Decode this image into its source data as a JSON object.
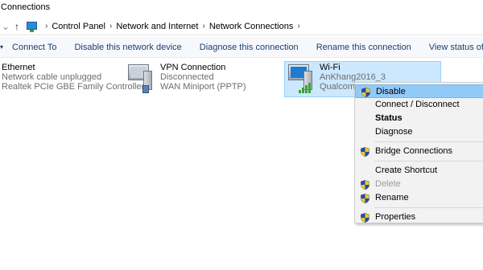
{
  "window": {
    "title": "Connections"
  },
  "address": {
    "back_icon": "chevron-down-icon",
    "up_icon": "up-arrow-icon",
    "breadcrumbs": [
      "Control Panel",
      "Network and Internet",
      "Network Connections"
    ]
  },
  "toolbar": {
    "buttons": [
      "Connect To",
      "Disable this network device",
      "Diagnose this connection",
      "Rename this connection",
      "View status of this connection"
    ]
  },
  "connections": {
    "ethernet": {
      "name": "Ethernet",
      "status": "Network cable unplugged",
      "device": "Realtek PCIe GBE Family Controller"
    },
    "vpn": {
      "name": "VPN Connection",
      "status": "Disconnected",
      "device": "WAN Miniport (PPTP)"
    },
    "wifi": {
      "name": "Wi-Fi",
      "status": "AnKhang2016_3",
      "device": "Qualcomm"
    }
  },
  "context_menu": {
    "items": [
      {
        "label": "Disable",
        "shield": true,
        "bold": false,
        "disabled": false,
        "highlighted": true
      },
      {
        "label": "Connect / Disconnect",
        "shield": false,
        "bold": false,
        "disabled": false,
        "highlighted": false
      },
      {
        "label": "Status",
        "shield": false,
        "bold": true,
        "disabled": false,
        "highlighted": false
      },
      {
        "label": "Diagnose",
        "shield": false,
        "bold": false,
        "disabled": false,
        "highlighted": false
      },
      {
        "label": "Bridge Connections",
        "shield": true,
        "bold": false,
        "disabled": false,
        "highlighted": false
      },
      {
        "label": "Create Shortcut",
        "shield": false,
        "bold": false,
        "disabled": false,
        "highlighted": false
      },
      {
        "label": "Delete",
        "shield": true,
        "bold": false,
        "disabled": true,
        "highlighted": false
      },
      {
        "label": "Rename",
        "shield": true,
        "bold": false,
        "disabled": false,
        "highlighted": false
      },
      {
        "label": "Properties",
        "shield": true,
        "bold": false,
        "disabled": false,
        "highlighted": false
      }
    ]
  },
  "colors": {
    "selection_bg": "#cce8ff",
    "menu_highlight": "#91c9f7",
    "toolbar_text": "#1c3f72",
    "signal": "#3aa23a"
  }
}
